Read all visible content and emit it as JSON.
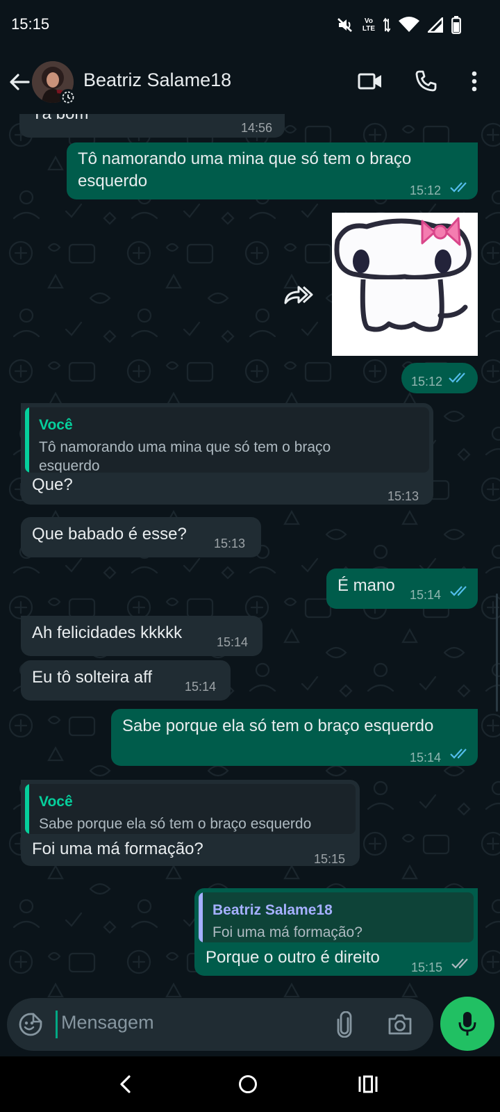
{
  "status_bar": {
    "time": "15:15",
    "network_top": "Vo",
    "network_bottom": "LTE",
    "icons": [
      "mute-icon",
      "volte-icon",
      "data-arrows-icon",
      "wifi-icon",
      "signal-icon",
      "battery-icon"
    ]
  },
  "header": {
    "contact_name": "Beatriz Salame18",
    "icons": [
      "back-arrow-icon",
      "avatar",
      "status-timer-icon",
      "video-call-icon",
      "voice-call-icon",
      "more-options-icon"
    ]
  },
  "messages": [
    {
      "direction": "in",
      "text": "Tá bom",
      "time": "14:56"
    },
    {
      "direction": "out",
      "text_lines": [
        "Tô namorando uma mina que só tem o braço",
        "esquerdo"
      ],
      "time": "15:12",
      "status": "read"
    },
    {
      "direction": "out",
      "type": "sticker",
      "time": "15:12",
      "status": "read"
    },
    {
      "direction": "in",
      "quote": {
        "author": "Você",
        "text_lines": [
          "Tô namorando uma mina que só tem o braço",
          "esquerdo"
        ]
      },
      "text": "Que?",
      "time": "15:13"
    },
    {
      "direction": "in",
      "text": "Que babado é esse?",
      "time": "15:13"
    },
    {
      "direction": "out",
      "text": "É mano",
      "time": "15:14",
      "status": "read"
    },
    {
      "direction": "in",
      "text": "Ah felicidades kkkkk",
      "time": "15:14"
    },
    {
      "direction": "in",
      "text": "Eu tô solteira aff",
      "time": "15:14"
    },
    {
      "direction": "out",
      "text": "Sabe porque ela só tem o braço esquerdo",
      "time": "15:14",
      "status": "read"
    },
    {
      "direction": "in",
      "quote": {
        "author": "Você",
        "text": "Sabe porque ela só tem o braço esquerdo"
      },
      "text": "Foi uma má formação?",
      "time": "15:15"
    },
    {
      "direction": "out",
      "quote": {
        "author": "Beatriz Salame18",
        "text": "Foi uma má formação?"
      },
      "text": "Porque o outro é direito",
      "time": "15:15",
      "status": "delivered"
    }
  ],
  "composer": {
    "placeholder": "Mensagem",
    "icons": [
      "emoji-icon",
      "attach-icon",
      "camera-icon",
      "mic-icon"
    ]
  },
  "nav_bar": {
    "icons": [
      "nav-back-icon",
      "nav-home-icon",
      "nav-recents-icon"
    ]
  },
  "colors": {
    "background": "#0b141a",
    "incoming_bubble": "#202c33",
    "outgoing_bubble": "#005c4b",
    "accent_green": "#21c063",
    "read_ticks": "#53bdeb",
    "quote_you": "#06cf9c",
    "quote_contact": "#a5b0ff"
  }
}
